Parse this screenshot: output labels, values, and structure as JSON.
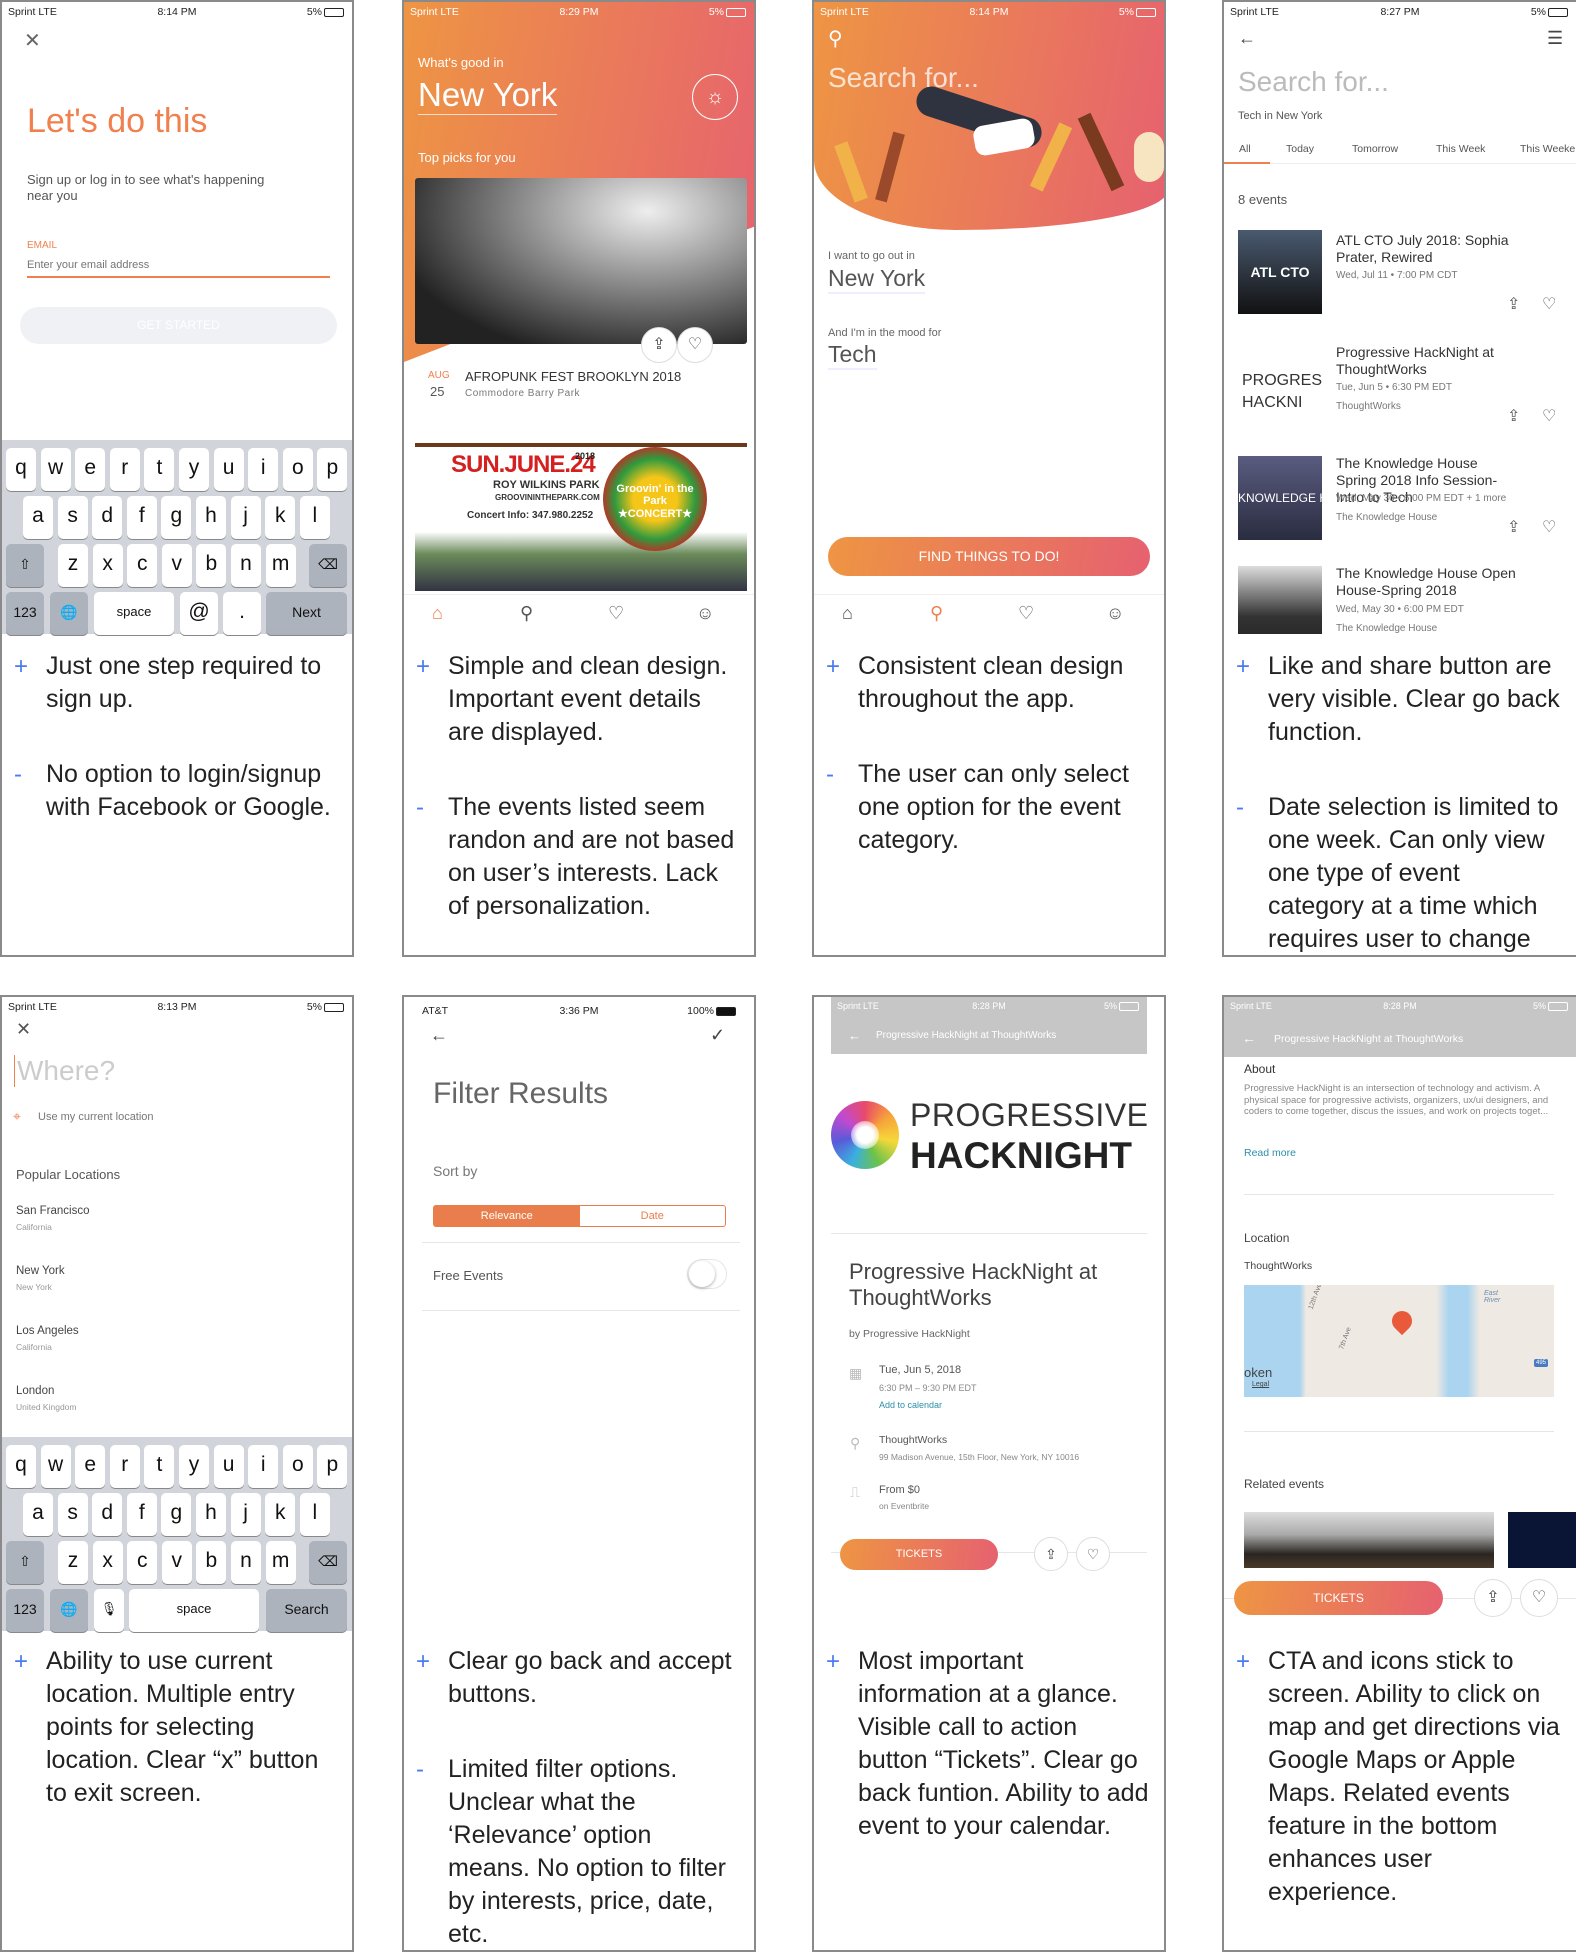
{
  "status": {
    "sprint": "Sprint",
    "lte": "LTE",
    "battery": "5%",
    "att": "AT&T",
    "battery_full": "100%",
    "icons": "⊕ ➚ ⏰ ✱"
  },
  "p1": {
    "time": "8:14 PM",
    "title": "Let's do this",
    "subtitle": "Sign up or log in to see what's happening near you",
    "email_label": "EMAIL",
    "email_placeholder": "Enter your email address",
    "button": "GET STARTED",
    "comments": [
      {
        "sign": "+",
        "text": "Just one step required to sign up."
      },
      {
        "sign": "-",
        "text": "No option to login/signup with Facebook or Google."
      }
    ]
  },
  "keyboard": {
    "row1": [
      "q",
      "w",
      "e",
      "r",
      "t",
      "y",
      "u",
      "i",
      "o",
      "p"
    ],
    "row2": [
      "a",
      "s",
      "d",
      "f",
      "g",
      "h",
      "j",
      "k",
      "l"
    ],
    "row3": [
      "z",
      "x",
      "c",
      "v",
      "b",
      "n",
      "m"
    ],
    "shift": "⇧",
    "delete": "⌫",
    "num": "123",
    "globe": "🌐",
    "mic": "🎙",
    "space": "space",
    "at": "@",
    "dot": ".",
    "next": "Next",
    "search": "Search"
  },
  "p2": {
    "time": "8:29 PM",
    "whats_good": "What's good in",
    "city": "New York",
    "top_picks": "Top picks for you",
    "event_month": "AUG",
    "event_day": "25",
    "event_title": "AFROPUNK FEST BROOKLYN 2018",
    "event_venue": "Commodore Barry Park",
    "poster_date": "SUN.JUNE.24",
    "poster_year": "2018",
    "poster_park": "ROY WILKINS PARK",
    "poster_site": "GROOVININTHEPARK.COM",
    "poster_info": "Concert Info: 347.980.2252",
    "poster_badge": "Groovin' in the Park",
    "poster_concert": "★CONCERT★",
    "comments": [
      {
        "sign": "+",
        "text": "Simple and clean design. Important event details are displayed."
      },
      {
        "sign": "-",
        "text": "The events listed seem randon and are not based on user’s interests. Lack of personalization."
      }
    ]
  },
  "p3": {
    "time": "8:14 PM",
    "search_placeholder": "Search for...",
    "go_out_label": "I want to go out in",
    "city": "New York",
    "mood_label": "And I'm in the mood for",
    "mood": "Tech",
    "button": "FIND THINGS TO DO!",
    "comments": [
      {
        "sign": "+",
        "text": "Consistent clean design throughout the app."
      },
      {
        "sign": "-",
        "text": "The user can only select one option for the event category."
      }
    ]
  },
  "p4": {
    "time": "8:27 PM",
    "search_placeholder": "Search for...",
    "context": "Tech in New York",
    "tabs": [
      "All",
      "Today",
      "Tomorrow",
      "This Week",
      "This Weeke"
    ],
    "count": "8 events",
    "events": [
      {
        "title": "ATL CTO July 2018: Sophia Prater, Rewired",
        "date": "Wed, Jul 11 • 7:00 PM CDT",
        "venue": "",
        "thumb": "ATL CTO"
      },
      {
        "title": "Progressive HackNight at ThoughtWorks",
        "date": "Tue, Jun 5 • 6:30 PM EDT",
        "venue": "ThoughtWorks",
        "thumb": "PROGRES HACKNI"
      },
      {
        "title": "The Knowledge House Spring 2018 Info Session- Intro to Tech",
        "date": "Wed, May 30 • 6:00 PM EDT + 1 more",
        "venue": "The Knowledge House",
        "thumb": "KNOWLEDGE H"
      },
      {
        "title": "The Knowledge House Open House-Spring 2018",
        "date": "Wed, May 30 • 6:00 PM EDT",
        "venue": "The Knowledge House",
        "thumb": ""
      }
    ],
    "comments": [
      {
        "sign": "+",
        "text": "Like and share button are very visible. Clear go back function."
      },
      {
        "sign": "-",
        "text": "Date selection is limited to one week. Can only view one type of event category at a time which requires user to change filters often."
      }
    ]
  },
  "p5": {
    "time": "8:13 PM",
    "placeholder": "Where?",
    "current_location": "Use my current location",
    "popular": "Popular Locations",
    "locations": [
      {
        "city": "San Francisco",
        "region": "California"
      },
      {
        "city": "New York",
        "region": "New York"
      },
      {
        "city": "Los Angeles",
        "region": "California"
      },
      {
        "city": "London",
        "region": "United Kingdom"
      }
    ],
    "comments": [
      {
        "sign": "+",
        "text": "Ability to use current location. Multiple entry points for selecting location. Clear “x” button to exit screen."
      }
    ]
  },
  "p6": {
    "time": "3:36 PM",
    "title": "Filter Results",
    "sort_by": "Sort by",
    "sort_options": [
      "Relevance",
      "Date"
    ],
    "free_events": "Free Events",
    "free_events_on": false,
    "comments": [
      {
        "sign": "+",
        "text": "Clear go back and accept buttons."
      },
      {
        "sign": "-",
        "text": "Limited filter options. Unclear what the ‘Relevance’ option means. No option to filter by interests, price, date, etc."
      }
    ]
  },
  "p7": {
    "time": "8:28 PM",
    "header": "Progressive HackNight at ThoughtWorks",
    "logo_line1": "PROGRESSIVE",
    "logo_line2": "HACKNIGHT",
    "title": "Progressive HackNight at ThoughtWorks",
    "organizer": "by Progressive HackNight",
    "date": "Tue, Jun 5, 2018",
    "time_range": "6:30 PM – 9:30 PM EDT",
    "add_calendar": "Add to calendar",
    "venue": "ThoughtWorks",
    "address": "99 Madison Avenue, 15th Floor, New York, NY 10016",
    "price": "From $0",
    "price_source": "on Eventbrite",
    "tickets": "TICKETS",
    "comments": [
      {
        "sign": "+",
        "text": "Most important information at a glance. Visible call to action button “Tickets”. Clear go back funtion. Ability to add event to your calendar."
      }
    ]
  },
  "p8": {
    "time": "8:28 PM",
    "header": "Progressive HackNight at ThoughtWorks",
    "about": "About",
    "about_text": "Progressive HackNight is an intersection of technology and activism. A physical space for progressive activists, organizers, ux/ui designers, and coders to come together, discus the issues, and work on projects toget...",
    "read_more": "Read more",
    "location": "Location",
    "venue": "ThoughtWorks",
    "map_labels": [
      "12th Ave",
      "7th Ave",
      "East River",
      "oken",
      "Legal",
      "495"
    ],
    "related": "Related events",
    "tickets": "TICKETS",
    "comments": [
      {
        "sign": "+",
        "text": "CTA and icons stick to screen. Ability to click on map and get directions via Google Maps or Apple Maps. Related events feature in the bottom enhances user experience."
      }
    ]
  },
  "colors": {
    "orange": "#f0804e",
    "pink": "#e66170",
    "blue_sign": "#4a7cf0",
    "link": "#2b8fa8"
  }
}
